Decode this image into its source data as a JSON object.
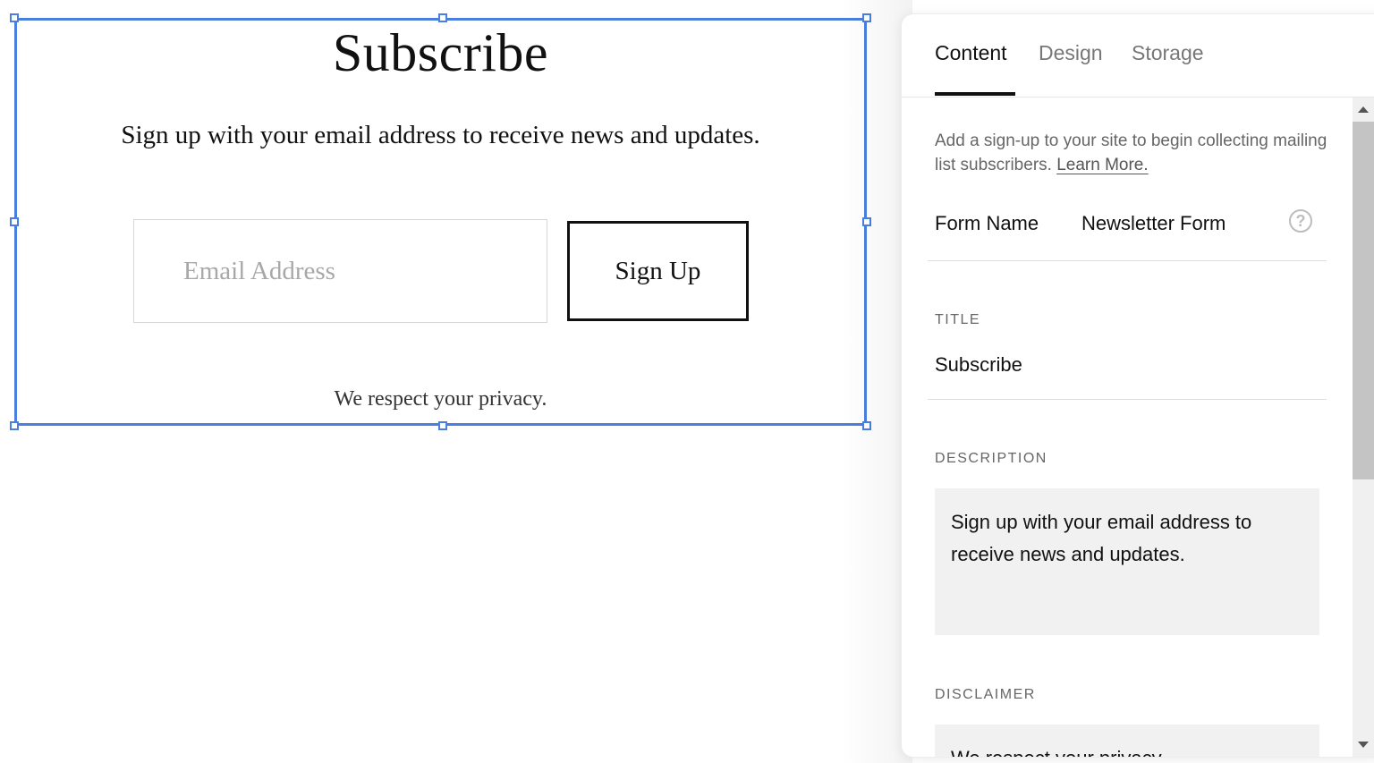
{
  "canvas": {
    "form": {
      "title": "Subscribe",
      "description": "Sign up with your email address to receive news and updates.",
      "email_placeholder": "Email Address",
      "email_value": "",
      "submit_label": "Sign Up",
      "disclaimer": "We respect your privacy."
    },
    "selection_color": "#4a7fe0"
  },
  "panel": {
    "tabs": [
      {
        "label": "Content",
        "active": true
      },
      {
        "label": "Design",
        "active": false
      },
      {
        "label": "Storage",
        "active": false
      }
    ],
    "intro_text": "Add a sign-up to your site to begin collecting mailing list subscribers.",
    "learn_more": "Learn More.",
    "form_name_label": "Form Name",
    "form_name_value": "Newsletter Form",
    "help_icon": "question-circle-icon",
    "help_glyph": "?",
    "title_label": "TITLE",
    "title_value": "Subscribe",
    "description_label": "DESCRIPTION",
    "description_value": "Sign up with your email address to receive news and updates.",
    "disclaimer_label": "DISCLAIMER",
    "disclaimer_value": "We respect your privacy."
  }
}
